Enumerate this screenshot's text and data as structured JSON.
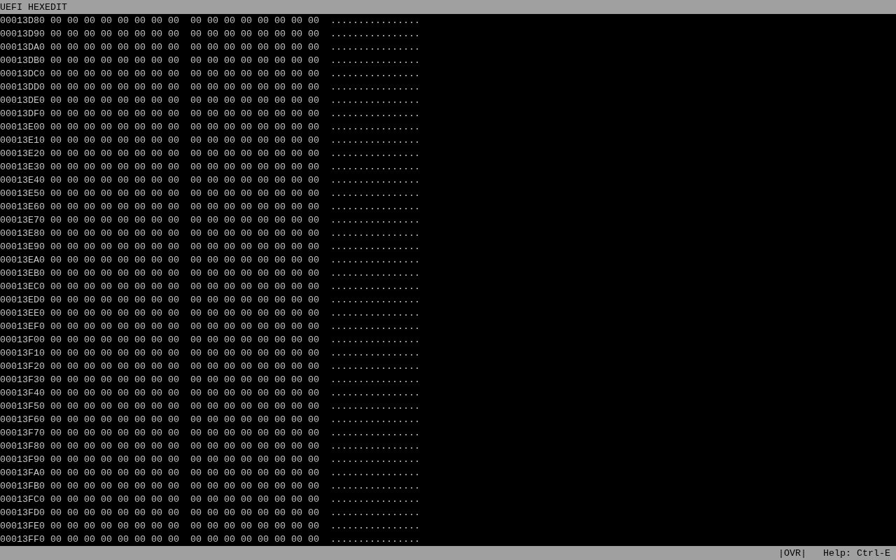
{
  "title_bar": {
    "title": "UEFI HEXEDIT"
  },
  "rows": [
    {
      "address": "00013D80",
      "bytes": [
        "00",
        "00",
        "00",
        "00",
        "00",
        "00",
        "00",
        "00",
        "00",
        "00",
        "00",
        "00",
        "00",
        "00",
        "00",
        "00"
      ],
      "ascii": "................"
    },
    {
      "address": "00013D90",
      "bytes": [
        "00",
        "00",
        "00",
        "00",
        "00",
        "00",
        "00",
        "00",
        "00",
        "00",
        "00",
        "00",
        "00",
        "00",
        "00",
        "00"
      ],
      "ascii": "................"
    },
    {
      "address": "00013DA0",
      "bytes": [
        "00",
        "00",
        "00",
        "00",
        "00",
        "00",
        "00",
        "00",
        "00",
        "00",
        "00",
        "00",
        "00",
        "00",
        "00",
        "00"
      ],
      "ascii": "................"
    },
    {
      "address": "00013DB0",
      "bytes": [
        "00",
        "00",
        "00",
        "00",
        "00",
        "00",
        "00",
        "00",
        "00",
        "00",
        "00",
        "00",
        "00",
        "00",
        "00",
        "00"
      ],
      "ascii": "................"
    },
    {
      "address": "00013DC0",
      "bytes": [
        "00",
        "00",
        "00",
        "00",
        "00",
        "00",
        "00",
        "00",
        "00",
        "00",
        "00",
        "00",
        "00",
        "00",
        "00",
        "00"
      ],
      "ascii": "................"
    },
    {
      "address": "00013DD0",
      "bytes": [
        "00",
        "00",
        "00",
        "00",
        "00",
        "00",
        "00",
        "00",
        "00",
        "00",
        "00",
        "00",
        "00",
        "00",
        "00",
        "00"
      ],
      "ascii": "................"
    },
    {
      "address": "00013DE0",
      "bytes": [
        "00",
        "00",
        "00",
        "00",
        "00",
        "00",
        "00",
        "00",
        "00",
        "00",
        "00",
        "00",
        "00",
        "00",
        "00",
        "00"
      ],
      "ascii": "................"
    },
    {
      "address": "00013DF0",
      "bytes": [
        "00",
        "00",
        "00",
        "00",
        "00",
        "00",
        "00",
        "00",
        "00",
        "00",
        "00",
        "00",
        "00",
        "00",
        "00",
        "00"
      ],
      "ascii": "................"
    },
    {
      "address": "00013E00",
      "bytes": [
        "00",
        "00",
        "00",
        "00",
        "00",
        "00",
        "00",
        "00",
        "00",
        "00",
        "00",
        "00",
        "00",
        "00",
        "00",
        "00"
      ],
      "ascii": "................"
    },
    {
      "address": "00013E10",
      "bytes": [
        "00",
        "00",
        "00",
        "00",
        "00",
        "00",
        "00",
        "00",
        "00",
        "00",
        "00",
        "00",
        "00",
        "00",
        "00",
        "00"
      ],
      "ascii": "................"
    },
    {
      "address": "00013E20",
      "bytes": [
        "00",
        "00",
        "00",
        "00",
        "00",
        "00",
        "00",
        "00",
        "00",
        "00",
        "00",
        "00",
        "00",
        "00",
        "00",
        "00"
      ],
      "ascii": "................"
    },
    {
      "address": "00013E30",
      "bytes": [
        "00",
        "00",
        "00",
        "00",
        "00",
        "00",
        "00",
        "00",
        "00",
        "00",
        "00",
        "00",
        "00",
        "00",
        "00",
        "00"
      ],
      "ascii": "................"
    },
    {
      "address": "00013E40",
      "bytes": [
        "00",
        "00",
        "00",
        "00",
        "00",
        "00",
        "00",
        "00",
        "00",
        "00",
        "00",
        "00",
        "00",
        "00",
        "00",
        "00"
      ],
      "ascii": "................"
    },
    {
      "address": "00013E50",
      "bytes": [
        "00",
        "00",
        "00",
        "00",
        "00",
        "00",
        "00",
        "00",
        "00",
        "00",
        "00",
        "00",
        "00",
        "00",
        "00",
        "00"
      ],
      "ascii": "................"
    },
    {
      "address": "00013E60",
      "bytes": [
        "00",
        "00",
        "00",
        "00",
        "00",
        "00",
        "00",
        "00",
        "00",
        "00",
        "00",
        "00",
        "00",
        "00",
        "00",
        "00"
      ],
      "ascii": "................"
    },
    {
      "address": "00013E70",
      "bytes": [
        "00",
        "00",
        "00",
        "00",
        "00",
        "00",
        "00",
        "00",
        "00",
        "00",
        "00",
        "00",
        "00",
        "00",
        "00",
        "00"
      ],
      "ascii": "................"
    },
    {
      "address": "00013E80",
      "bytes": [
        "00",
        "00",
        "00",
        "00",
        "00",
        "00",
        "00",
        "00",
        "00",
        "00",
        "00",
        "00",
        "00",
        "00",
        "00",
        "00"
      ],
      "ascii": "................"
    },
    {
      "address": "00013E90",
      "bytes": [
        "00",
        "00",
        "00",
        "00",
        "00",
        "00",
        "00",
        "00",
        "00",
        "00",
        "00",
        "00",
        "00",
        "00",
        "00",
        "00"
      ],
      "ascii": "................"
    },
    {
      "address": "00013EA0",
      "bytes": [
        "00",
        "00",
        "00",
        "00",
        "00",
        "00",
        "00",
        "00",
        "00",
        "00",
        "00",
        "00",
        "00",
        "00",
        "00",
        "00"
      ],
      "ascii": "................"
    },
    {
      "address": "00013EB0",
      "bytes": [
        "00",
        "00",
        "00",
        "00",
        "00",
        "00",
        "00",
        "00",
        "00",
        "00",
        "00",
        "00",
        "00",
        "00",
        "00",
        "00"
      ],
      "ascii": "................"
    },
    {
      "address": "00013EC0",
      "bytes": [
        "00",
        "00",
        "00",
        "00",
        "00",
        "00",
        "00",
        "00",
        "00",
        "00",
        "00",
        "00",
        "00",
        "00",
        "00",
        "00"
      ],
      "ascii": "................"
    },
    {
      "address": "00013ED0",
      "bytes": [
        "00",
        "00",
        "00",
        "00",
        "00",
        "00",
        "00",
        "00",
        "00",
        "00",
        "00",
        "00",
        "00",
        "00",
        "00",
        "00"
      ],
      "ascii": "................"
    },
    {
      "address": "00013EE0",
      "bytes": [
        "00",
        "00",
        "00",
        "00",
        "00",
        "00",
        "00",
        "00",
        "00",
        "00",
        "00",
        "00",
        "00",
        "00",
        "00",
        "00"
      ],
      "ascii": "................"
    },
    {
      "address": "00013EF0",
      "bytes": [
        "00",
        "00",
        "00",
        "00",
        "00",
        "00",
        "00",
        "00",
        "00",
        "00",
        "00",
        "00",
        "00",
        "00",
        "00",
        "00"
      ],
      "ascii": "................"
    },
    {
      "address": "00013F00",
      "bytes": [
        "00",
        "00",
        "00",
        "00",
        "00",
        "00",
        "00",
        "00",
        "00",
        "00",
        "00",
        "00",
        "00",
        "00",
        "00",
        "00"
      ],
      "ascii": "................"
    },
    {
      "address": "00013F10",
      "bytes": [
        "00",
        "00",
        "00",
        "00",
        "00",
        "00",
        "00",
        "00",
        "00",
        "00",
        "00",
        "00",
        "00",
        "00",
        "00",
        "00"
      ],
      "ascii": "................"
    },
    {
      "address": "00013F20",
      "bytes": [
        "00",
        "00",
        "00",
        "00",
        "00",
        "00",
        "00",
        "00",
        "00",
        "00",
        "00",
        "00",
        "00",
        "00",
        "00",
        "00"
      ],
      "ascii": "................"
    },
    {
      "address": "00013F30",
      "bytes": [
        "00",
        "00",
        "00",
        "00",
        "00",
        "00",
        "00",
        "00",
        "00",
        "00",
        "00",
        "00",
        "00",
        "00",
        "00",
        "00"
      ],
      "ascii": "................"
    },
    {
      "address": "00013F40",
      "bytes": [
        "00",
        "00",
        "00",
        "00",
        "00",
        "00",
        "00",
        "00",
        "00",
        "00",
        "00",
        "00",
        "00",
        "00",
        "00",
        "00"
      ],
      "ascii": "................"
    },
    {
      "address": "00013F50",
      "bytes": [
        "00",
        "00",
        "00",
        "00",
        "00",
        "00",
        "00",
        "00",
        "00",
        "00",
        "00",
        "00",
        "00",
        "00",
        "00",
        "00"
      ],
      "ascii": "................"
    },
    {
      "address": "00013F60",
      "bytes": [
        "00",
        "00",
        "00",
        "00",
        "00",
        "00",
        "00",
        "00",
        "00",
        "00",
        "00",
        "00",
        "00",
        "00",
        "00",
        "00"
      ],
      "ascii": "................"
    },
    {
      "address": "00013F70",
      "bytes": [
        "00",
        "00",
        "00",
        "00",
        "00",
        "00",
        "00",
        "00",
        "00",
        "00",
        "00",
        "00",
        "00",
        "00",
        "00",
        "00"
      ],
      "ascii": "................"
    },
    {
      "address": "00013F80",
      "bytes": [
        "00",
        "00",
        "00",
        "00",
        "00",
        "00",
        "00",
        "00",
        "00",
        "00",
        "00",
        "00",
        "00",
        "00",
        "00",
        "00"
      ],
      "ascii": "................"
    },
    {
      "address": "00013F90",
      "bytes": [
        "00",
        "00",
        "00",
        "00",
        "00",
        "00",
        "00",
        "00",
        "00",
        "00",
        "00",
        "00",
        "00",
        "00",
        "00",
        "00"
      ],
      "ascii": "................"
    },
    {
      "address": "00013FA0",
      "bytes": [
        "00",
        "00",
        "00",
        "00",
        "00",
        "00",
        "00",
        "00",
        "00",
        "00",
        "00",
        "00",
        "00",
        "00",
        "00",
        "00"
      ],
      "ascii": "................"
    },
    {
      "address": "00013FB0",
      "bytes": [
        "00",
        "00",
        "00",
        "00",
        "00",
        "00",
        "00",
        "00",
        "00",
        "00",
        "00",
        "00",
        "00",
        "00",
        "00",
        "00"
      ],
      "ascii": "................"
    },
    {
      "address": "00013FC0",
      "bytes": [
        "00",
        "00",
        "00",
        "00",
        "00",
        "00",
        "00",
        "00",
        "00",
        "00",
        "00",
        "00",
        "00",
        "00",
        "00",
        "00"
      ],
      "ascii": "................"
    },
    {
      "address": "00013FD0",
      "bytes": [
        "00",
        "00",
        "00",
        "00",
        "00",
        "00",
        "00",
        "00",
        "00",
        "00",
        "00",
        "00",
        "00",
        "00",
        "00",
        "00"
      ],
      "ascii": "................"
    },
    {
      "address": "00013FE0",
      "bytes": [
        "00",
        "00",
        "00",
        "00",
        "00",
        "00",
        "00",
        "00",
        "00",
        "00",
        "00",
        "00",
        "00",
        "00",
        "00",
        "00"
      ],
      "ascii": "................"
    },
    {
      "address": "00013FF0",
      "bytes": [
        "00",
        "00",
        "00",
        "00",
        "00",
        "00",
        "00",
        "00",
        "00",
        "00",
        "00",
        "00",
        "00",
        "00",
        "00",
        "00"
      ],
      "ascii": "................"
    }
  ],
  "status_bar": {
    "mode": "|OVR|",
    "help": "Help: Ctrl-E"
  }
}
